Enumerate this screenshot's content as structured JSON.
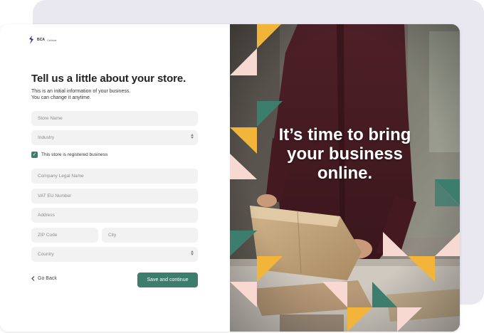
{
  "brand": {
    "name": "BCA",
    "suffix": "Cellular"
  },
  "form": {
    "title": "Tell us a little about your store.",
    "subtitle_line1": "This is an initial information of your business.",
    "subtitle_line2": "You can change it anytime.",
    "store_name_placeholder": "Store Name",
    "industry_placeholder": "Industry",
    "registered_checkbox_label": "This store is registered business",
    "registered_checked": true,
    "company_legal_name_placeholder": "Company Legal Name",
    "vat_placeholder": "VAT EU Number",
    "address_placeholder": "Address",
    "zip_placeholder": "ZIP Code",
    "city_placeholder": "City",
    "country_placeholder": "Country",
    "back_label": "Go Back",
    "save_label": "Save and continue"
  },
  "hero": {
    "line1": "It’s time to bring",
    "line2": "your business",
    "line3": "online."
  },
  "colors": {
    "accent": "#3d7d6e",
    "yellow": "#f2b53a",
    "pink": "#f7d9d2",
    "back_card": "#e9e8f1"
  }
}
